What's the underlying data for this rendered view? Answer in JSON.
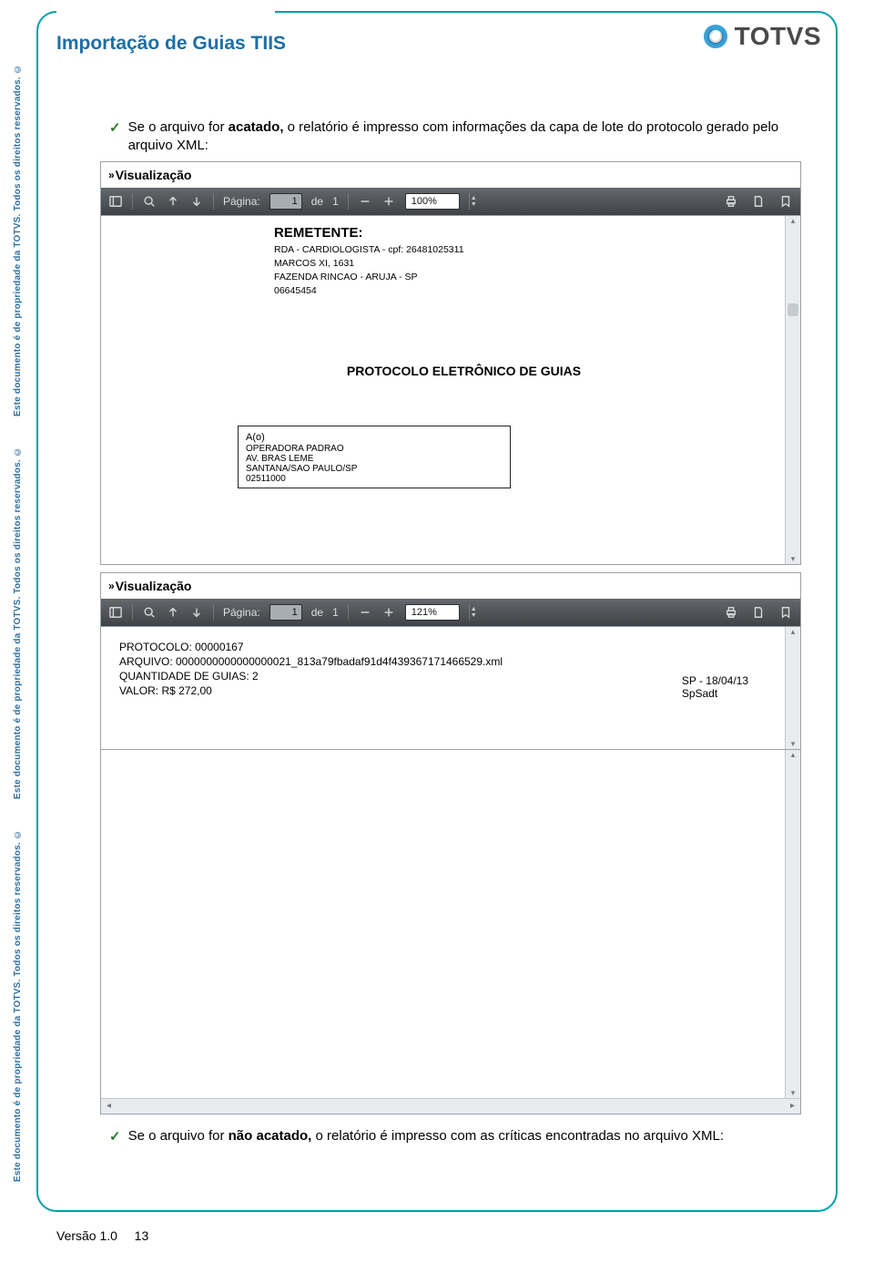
{
  "watermark": "Este documento é de propriedade da TOTVS. Todos os direitos reservados. ©",
  "header": {
    "title": "Importação de Guias TIIS",
    "logo_text": "TOTVS"
  },
  "bullets": {
    "b1_pre": "Se o arquivo for ",
    "b1_bold": "acatado,",
    "b1_post": " o relatório é impresso com informações da capa de lote do protocolo gerado pelo arquivo XML:",
    "b2_pre": "Se o arquivo for ",
    "b2_bold": "não acatado,",
    "b2_post": " o relatório é impresso com as críticas encontradas no arquivo XML:"
  },
  "viewer_common": {
    "visualizacao": "Visualização",
    "pagina_label": "Página:",
    "de": "de",
    "total_pages": "1"
  },
  "viewer1": {
    "page": "1",
    "zoom": "100%",
    "remetente_title": "REMETENTE:",
    "line1": "RDA - CARDIOLOGISTA - cpf: 26481025311",
    "line2": "MARCOS XI, 1631",
    "line3": "FAZENDA RINCAO - ARUJA - SP",
    "line4": "06645454",
    "protocolo_title": "PROTOCOLO ELETRÔNICO DE GUIAS",
    "ao": "A(o)",
    "op1": "OPERADORA PADRAO",
    "op2": "AV. BRAS LEME",
    "op3": "SANTANA/SAO PAULO/SP",
    "op4": "02511000"
  },
  "viewer2": {
    "page": "1",
    "zoom": "121%",
    "l1": "PROTOCOLO: 00000167",
    "l2": "ARQUIVO: 0000000000000000021_813a79fbadaf91d4f439367171466529.xml",
    "l3": "QUANTIDADE DE GUIAS: 2",
    "l4": "VALOR: R$ 272,00",
    "r1": "SP - 18/04/13",
    "r2": "SpSadt"
  },
  "footer": {
    "version": "Versão 1.0",
    "page": "13"
  }
}
